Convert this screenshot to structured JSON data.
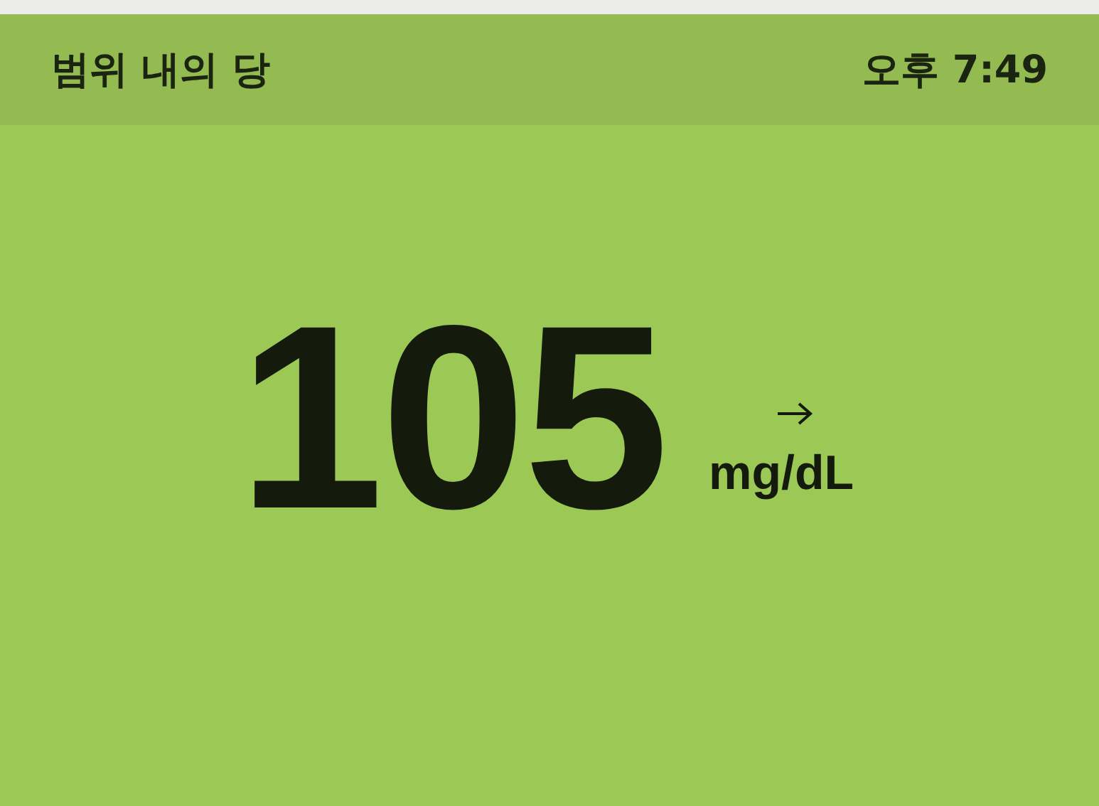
{
  "header": {
    "title": "범위 내의 당",
    "time": "오후 7:49"
  },
  "reading": {
    "value": "105",
    "unit": "mg/dL"
  }
}
